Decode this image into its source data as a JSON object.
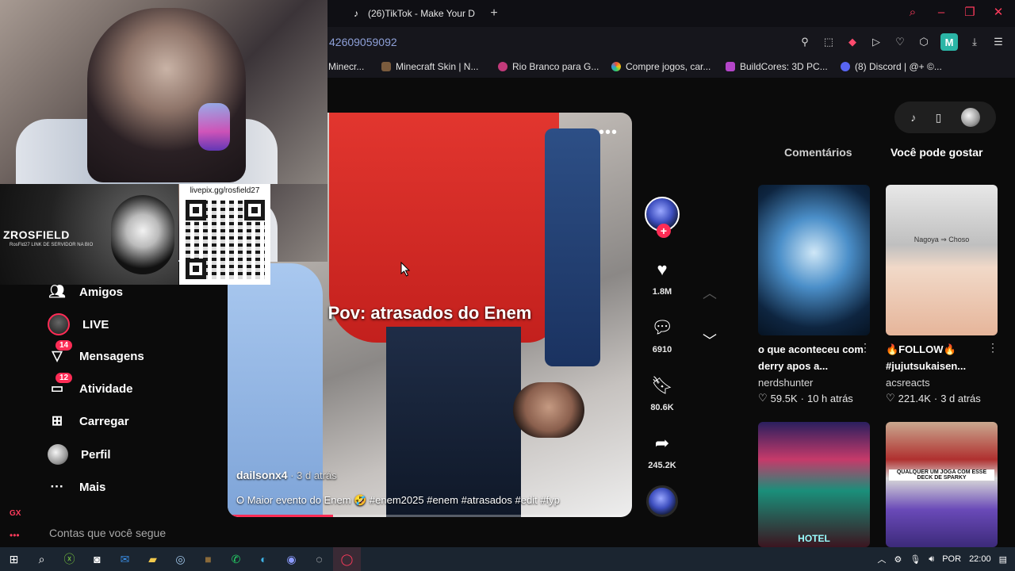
{
  "browser": {
    "tab_title": "(26)TikTok - Make Your D",
    "url_fragment": "42609059092",
    "bookmarks": [
      "Minecr...",
      "Minecraft Skin | N...",
      "Rio Branco para G...",
      "Compre jogos, car...",
      "BuildCores: 3D PC...",
      "(8) Discord | @+ ©..."
    ],
    "profile_initial": "M",
    "accent": "#ff3b5c"
  },
  "overlay": {
    "brand": "ZROSFIELD",
    "brand_sub": "RosFld27  LINK DE SERVIDOR NA BIO",
    "qr_label": "livepix.gg/rosfield27"
  },
  "sidebar": {
    "items": [
      {
        "label": "Amigos",
        "icon": "friends-icon"
      },
      {
        "label": "LIVE",
        "icon": "live-avatar"
      },
      {
        "label": "Mensagens",
        "icon": "messages-icon",
        "badge": "14"
      },
      {
        "label": "Atividade",
        "icon": "activity-icon",
        "badge": "12"
      },
      {
        "label": "Carregar",
        "icon": "upload-icon"
      },
      {
        "label": "Perfil",
        "icon": "profile-avatar"
      },
      {
        "label": "Mais",
        "icon": "more-icon"
      }
    ],
    "following_title": "Contas que você segue",
    "gx_label": "GX",
    "gx_more": "•••"
  },
  "video": {
    "caption": "Pov: atrasados do Enem",
    "author": "dailsonx4",
    "time": " · 3 d atrás",
    "description": "O Maior evento do Enem 🤣 #enem2025 #enem #atrasados #edit #fyp",
    "more": "•••",
    "progress": 0.26
  },
  "actions": {
    "likes": "1.8M",
    "comments": "6910",
    "saves": "80.6K",
    "shares": "245.2K",
    "follow_plus": "+"
  },
  "right_panel": {
    "tabs": [
      "Comentários",
      "Você pode gostar"
    ],
    "cards": [
      {
        "title": "o que aconteceu com derry apos a...",
        "author": "nerdshunter",
        "likes": "59.5K",
        "time": "10 h atrás"
      },
      {
        "title": "🔥FOLLOW🔥 #jujutsukaisen...",
        "author": "acsreacts",
        "likes": "221.4K",
        "time": "3 d atrás"
      }
    ],
    "thumb_texts": [
      "Nagoya ⇒ Choso",
      "QUALQUER UM JOGA COM ESSE DECK DE SPARKY",
      "HOTEL"
    ]
  },
  "taskbar": {
    "lang": "POR",
    "clock": "22:00"
  }
}
